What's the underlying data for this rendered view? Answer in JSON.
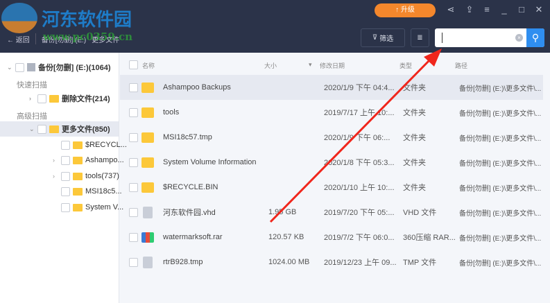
{
  "logo": {
    "text": "河东软件园",
    "watermark": "www.pc0359.cn"
  },
  "breadcrumb": {
    "back": "← 返回",
    "drive": "备份[勿删] (E:)",
    "folder": "更多文件"
  },
  "header": {
    "upgrade": "升级",
    "filter": "筛选"
  },
  "search": {
    "value": "",
    "clear": "×"
  },
  "tree": {
    "root": "备份[勿删] (E:)(1064)",
    "quick_scan": "快速扫描",
    "deleted": "删除文件(214)",
    "advanced_scan": "高级扫描",
    "more": "更多文件(850)",
    "children": [
      "$RECYCL...",
      "Ashampo...",
      "tools(737)",
      "MSI18c5...",
      "System V..."
    ]
  },
  "columns": {
    "name": "名称",
    "size": "大小",
    "date": "修改日期",
    "type": "类型",
    "path": "路径"
  },
  "rows": [
    {
      "name": "Ashampoo Backups",
      "size": "",
      "date": "2020/1/9 下午 04:4...",
      "type": "文件夹",
      "path": "备份[勿删] (E:)\\更多文件\\...",
      "icon": "folder"
    },
    {
      "name": "tools",
      "size": "",
      "date": "2019/7/17 上午 10:...",
      "type": "文件夹",
      "path": "备份[勿删] (E:)\\更多文件\\...",
      "icon": "folder"
    },
    {
      "name": "MSI18c57.tmp",
      "size": "",
      "date": "2020/1/9 下午 06:...",
      "type": "文件夹",
      "path": "备份[勿删] (E:)\\更多文件\\...",
      "icon": "folder"
    },
    {
      "name": "System Volume Information",
      "size": "",
      "date": "2020/1/8 下午 05:3...",
      "type": "文件夹",
      "path": "备份[勿删] (E:)\\更多文件\\...",
      "icon": "folder"
    },
    {
      "name": "$RECYCLE.BIN",
      "size": "",
      "date": "2020/1/10 上午 10:...",
      "type": "文件夹",
      "path": "备份[勿删] (E:)\\更多文件\\...",
      "icon": "folder"
    },
    {
      "name": "河东软件园.vhd",
      "size": "1.95 GB",
      "date": "2019/7/20 下午 05:...",
      "type": "VHD 文件",
      "path": "备份[勿删] (E:)\\更多文件\\...",
      "icon": "file"
    },
    {
      "name": "watermarksoft.rar",
      "size": "120.57 KB",
      "date": "2019/7/2 下午 06:0...",
      "type": "360压缩 RAR...",
      "path": "备份[勿删] (E:)\\更多文件\\...",
      "icon": "rar"
    },
    {
      "name": "rtrB928.tmp",
      "size": "1024.00 MB",
      "date": "2019/12/23 上午 09...",
      "type": "TMP 文件",
      "path": "备份[勿删] (E:)\\更多文件\\...",
      "icon": "file"
    }
  ]
}
